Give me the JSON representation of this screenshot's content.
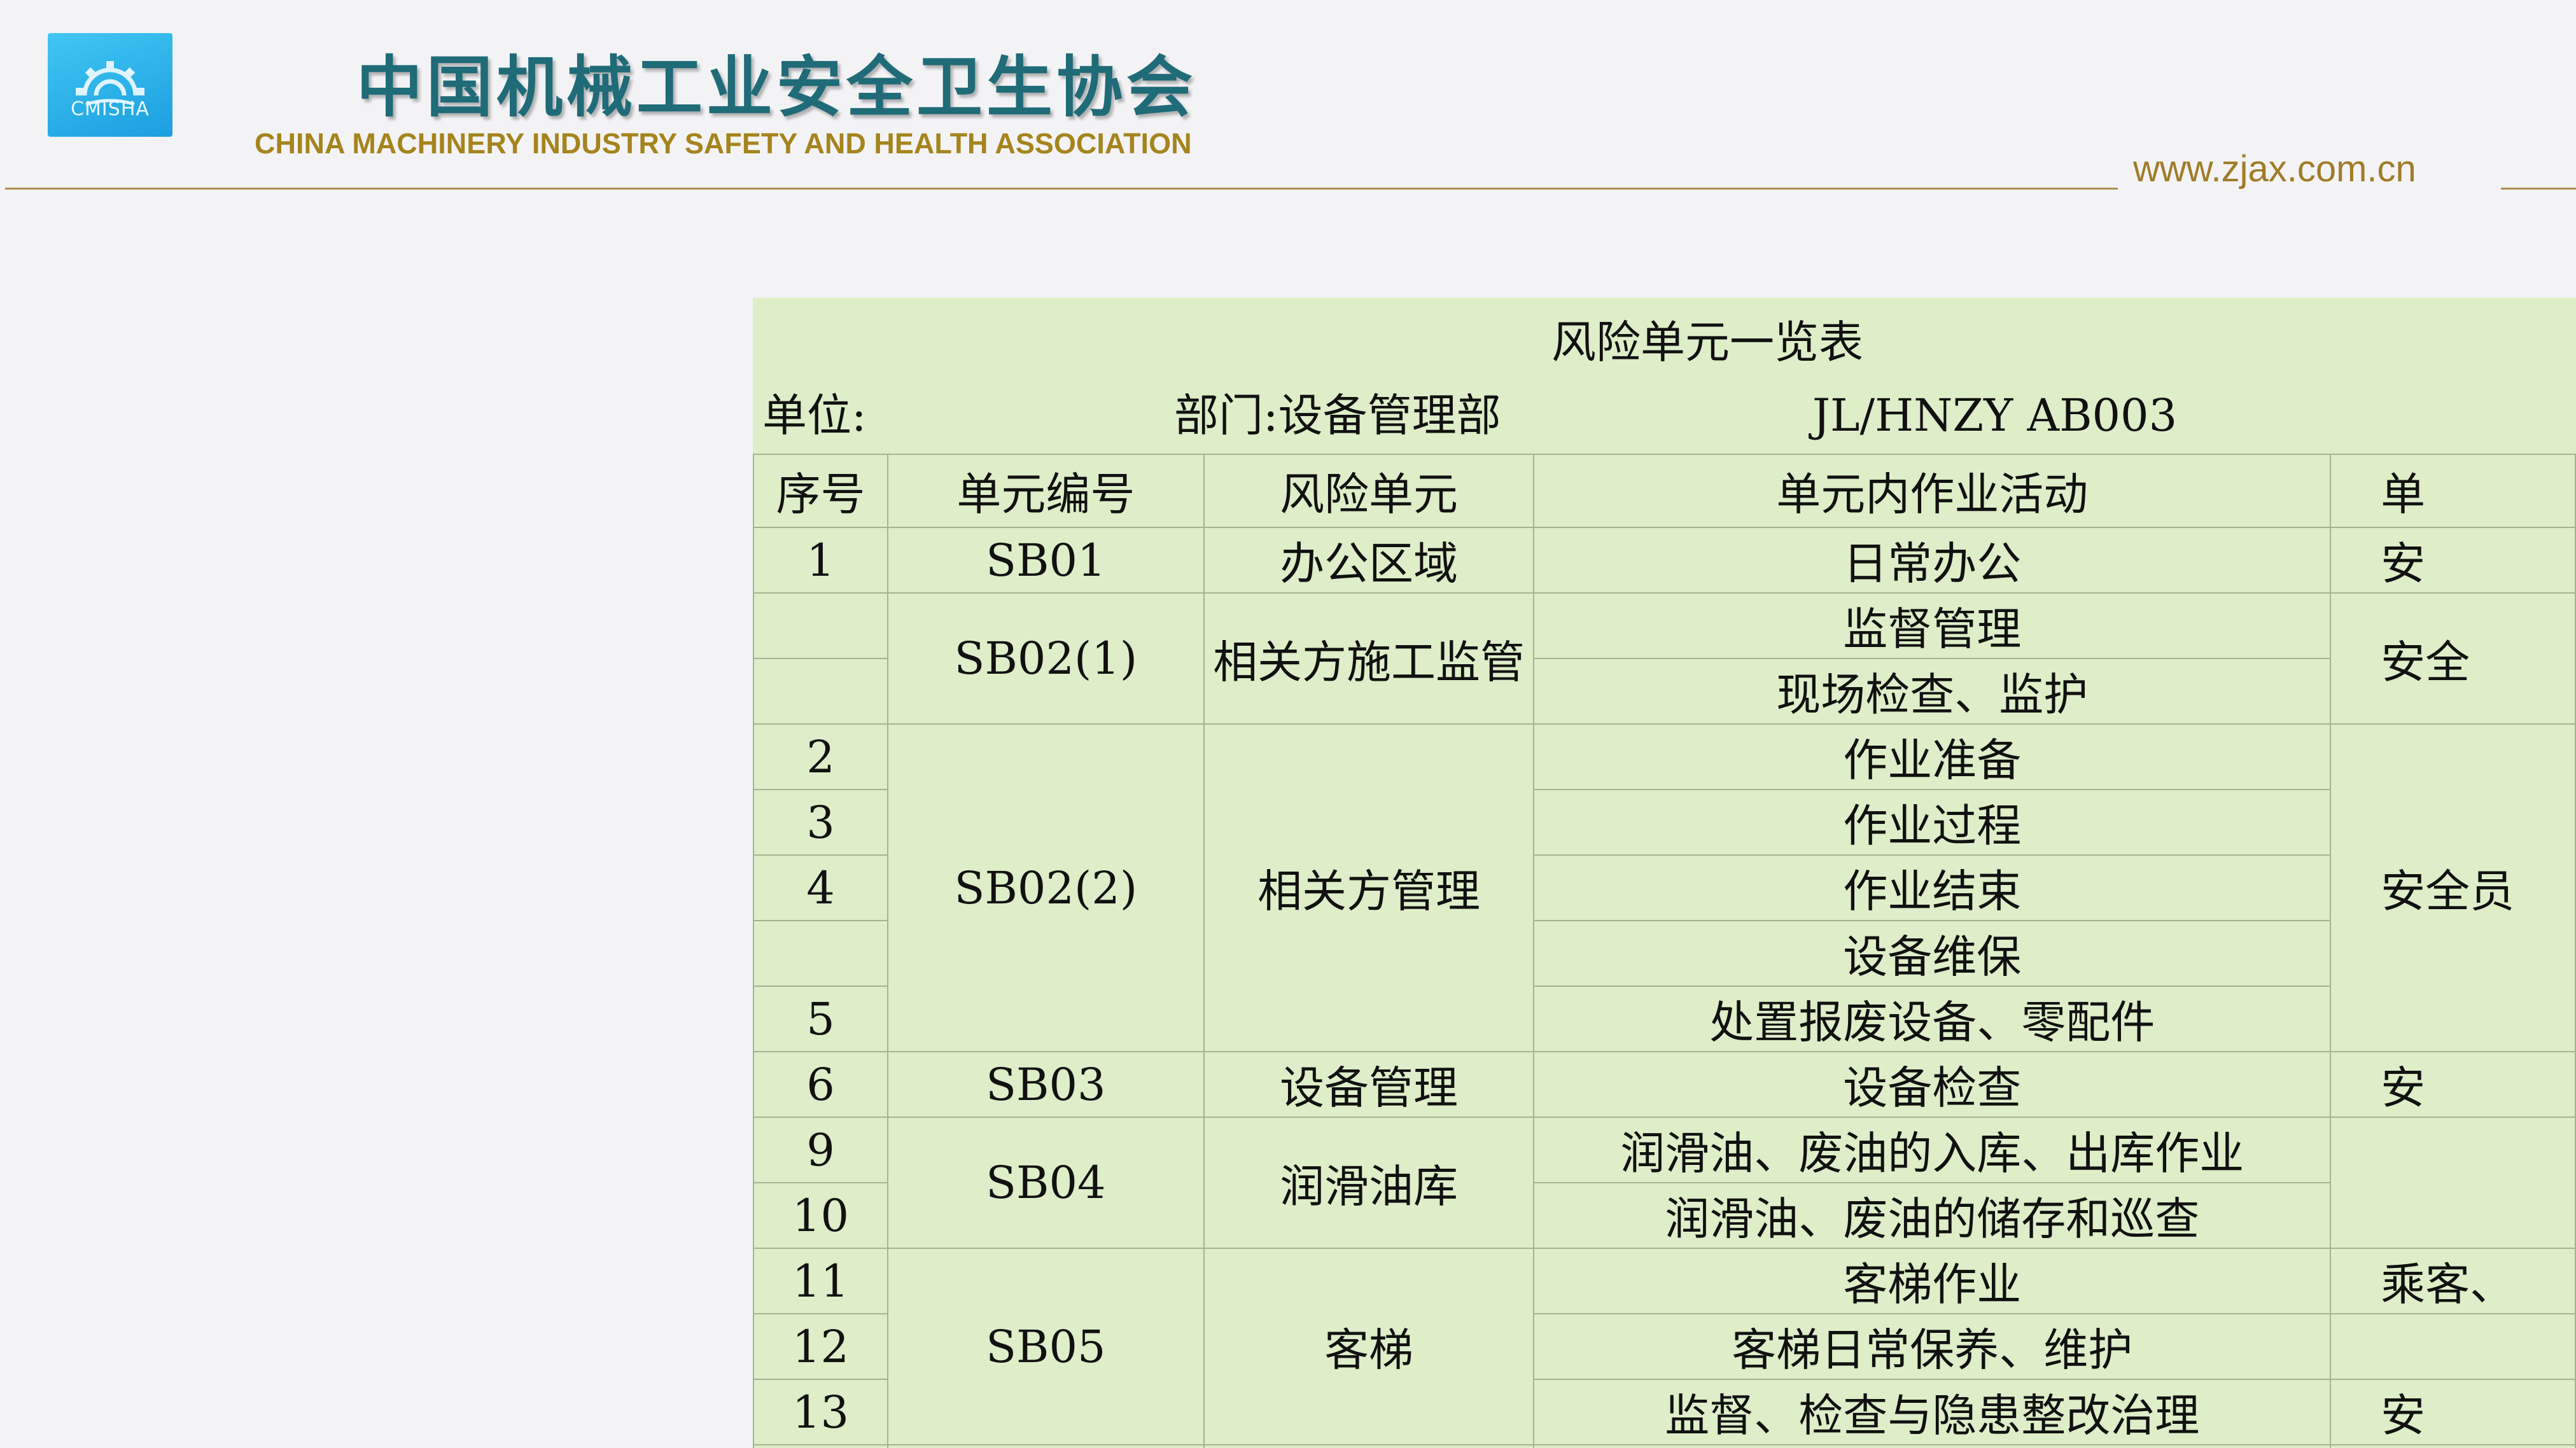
{
  "header": {
    "logo_text": "CMISHA",
    "title_cn": "中国机械工业安全卫生协会",
    "title_en": "CHINA MACHINERY INDUSTRY SAFETY AND HEALTH ASSOCIATION",
    "url": "www.zjax.com.cn"
  },
  "sheet": {
    "title": "风险单元一览表",
    "unit_label": "单位:",
    "dept_label": "部门:设备管理部",
    "code": "JL/HNZY  AB003",
    "columns": [
      "序号",
      "单元编号",
      "风险单元",
      "单元内作业活动",
      "单"
    ],
    "rows": [
      {
        "no": "1",
        "code": "SB01",
        "unit": "办公区域",
        "activity": "日常办公",
        "resp": "安"
      },
      {
        "no": "",
        "code": "SB02(1)",
        "unit": "相关方施工监管",
        "activity": "监督管理",
        "resp": "安全"
      },
      {
        "no": "",
        "activity": "现场检查、监护"
      },
      {
        "no": "2",
        "code": "SB02(2)",
        "unit": "相关方管理",
        "activity": "作业准备",
        "resp": "安全员"
      },
      {
        "no": "3",
        "activity": "作业过程"
      },
      {
        "no": "4",
        "activity": "作业结束"
      },
      {
        "no": "",
        "activity": "设备维保"
      },
      {
        "no": "5",
        "activity": "处置报废设备、零配件"
      },
      {
        "no": "6",
        "code": "SB03",
        "unit": "设备管理",
        "activity": "设备检查",
        "resp": "安"
      },
      {
        "no": "9",
        "code": "SB04",
        "unit": "润滑油库",
        "activity": "润滑油、废油的入库、出库作业",
        "resp": ""
      },
      {
        "no": "10",
        "activity": "润滑油、废油的储存和巡查"
      },
      {
        "no": "11",
        "code": "SB05",
        "unit": "客梯",
        "activity": "客梯作业",
        "resp": "乘客、"
      },
      {
        "no": "12",
        "activity": "客梯日常保养、维护",
        "resp": ""
      },
      {
        "no": "13",
        "activity": "监督、检查与隐患整改治理",
        "resp": "安"
      },
      {
        "no": "",
        "activity": "",
        "resp": ""
      }
    ]
  }
}
